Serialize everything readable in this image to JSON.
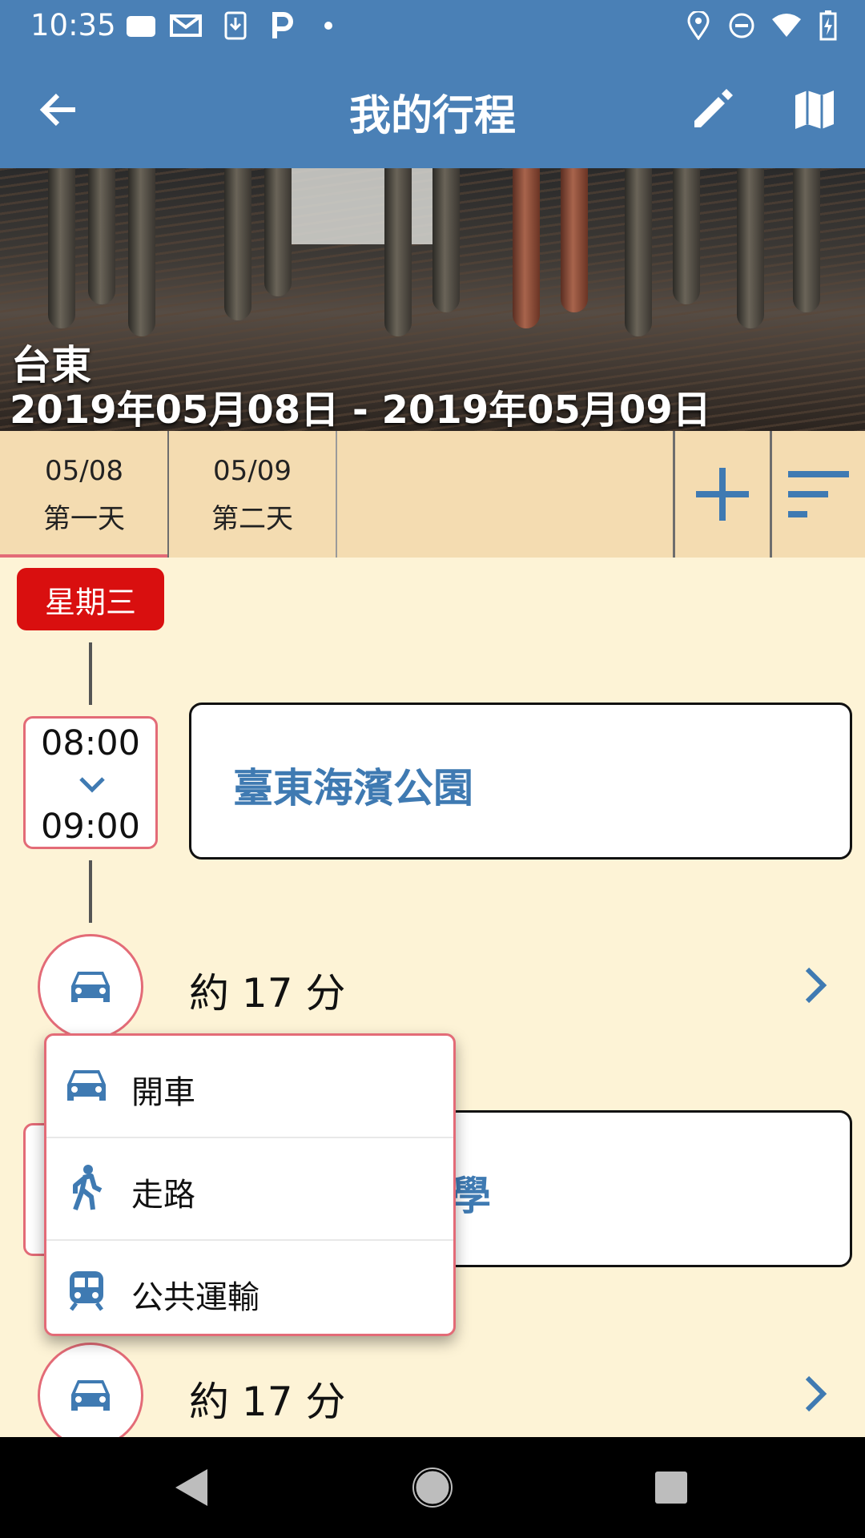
{
  "status_bar": {
    "time": "10:35",
    "left_icons": [
      "photo-icon",
      "gmail-icon",
      "download-icon",
      "parking-icon",
      "dot-icon"
    ],
    "right_icons": [
      "location-icon",
      "do-not-disturb-icon",
      "wifi-icon",
      "battery-icon"
    ]
  },
  "app_bar": {
    "title": "我的行程",
    "back_icon": "arrow-left-icon",
    "edit_icon": "pencil-icon",
    "map_icon": "map-icon",
    "color": "#4a80b6"
  },
  "banner": {
    "city": "台東",
    "date_range": "2019年05月08日 - 2019年05月09日"
  },
  "day_tabs": {
    "tabs": [
      {
        "date": "05/08",
        "label": "第一天",
        "active": true
      },
      {
        "date": "05/09",
        "label": "第二天",
        "active": false
      }
    ],
    "add_icon": "plus-icon",
    "sort_icon": "sort-icon"
  },
  "timeline": {
    "weekday": "星期三",
    "stop1": {
      "start": "08:00",
      "end": "09:00",
      "name": "臺東海濱公園"
    },
    "leg1": {
      "mode_icon": "car-icon",
      "duration": "約 17 分"
    },
    "stop2": {
      "name_visible_fragment": "學"
    },
    "leg2": {
      "mode_icon": "car-icon",
      "duration": "約 17 分"
    }
  },
  "transport_menu": {
    "items": [
      {
        "icon": "car-icon",
        "label": "開車"
      },
      {
        "icon": "walk-icon",
        "label": "走路"
      },
      {
        "icon": "train-icon",
        "label": "公共運輸"
      }
    ]
  },
  "colors": {
    "accent_blue": "#3f7ab2",
    "weekday_red": "#d90f0f",
    "outline_pink": "#e36b77",
    "background": "#fdf3d6",
    "tab_background": "#f4dcb1"
  }
}
